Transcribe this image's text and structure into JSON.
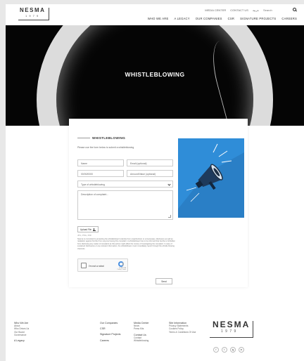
{
  "header": {
    "logo_text": "NESMA",
    "logo_sub": "1 9 7 9",
    "utility_links": [
      "MEDIA CENTER",
      "CONTACT US",
      "عربية"
    ],
    "search_placeholder": "Search",
    "nav": [
      "WHO WE ARE",
      "A LEGACY",
      "OUR COMPANIES",
      "CSR",
      "SIGNATURE PROJECTS",
      "CAREERS"
    ]
  },
  "hero": {
    "title": "WHISTLEBLOWING"
  },
  "form": {
    "title": "WHISTLEBLOWING",
    "intro": "Please use the form below to submit a whistleblowing",
    "name_placeholder": "Name",
    "email_placeholder": "Email (optional)",
    "date_value": "00/00/0000",
    "amount_placeholder": "Amount/Value (optional)",
    "type_placeholder": "Type of whistleblowing",
    "description_placeholder": "Description of complaint...",
    "upload_label": "Upload File",
    "file_hint": "JPG, PNG, PDF",
    "consent_text": "Nesma is committed to protecting the whistleblower's identity from unauthorized, or unnecessary, disclosure as well as retaliation against him/her from anyone having this complaint. A whistleblower has to be informed that he/she is forbidden from disclosing any matter of complaint as this action might affect the course of investigating the complaint. In case of sustained disclosures or any relevant information, the whistleblower must immediately report through the whistle blowing channels.",
    "captcha_label": "I'm not a robot",
    "captcha_brand": "reCAPTCHA",
    "captcha_sub": "Privacy - Terms",
    "send_label": "Send"
  },
  "footer": {
    "who_we_are": {
      "heading": "Who We Are",
      "items": [
        "About",
        "Who Drives Us",
        "Our Board",
        "Governance"
      ]
    },
    "legacy": "A Legacy",
    "companies": {
      "heading": "Our Companies",
      "csr": "CSR",
      "signature": "Signature Projects",
      "careers": "Careers"
    },
    "media": {
      "heading": "Media Center",
      "items": [
        "News",
        "Press Kits"
      ]
    },
    "contact": {
      "heading": "Contact Us",
      "items": [
        "Contact",
        "Whistleblowing"
      ]
    },
    "site_info": {
      "heading": "Site Information",
      "items": [
        "Privacy Statements",
        "Cookies Policy",
        "Terms & Conditions Of Use"
      ]
    },
    "logo_text": "NESMA",
    "logo_sub": "1 9 7 9",
    "socials": [
      "f",
      "t",
      "ig",
      "in"
    ]
  },
  "colors": {
    "accent_blue": "#2f8dd8",
    "hero_bg": "#050505"
  }
}
